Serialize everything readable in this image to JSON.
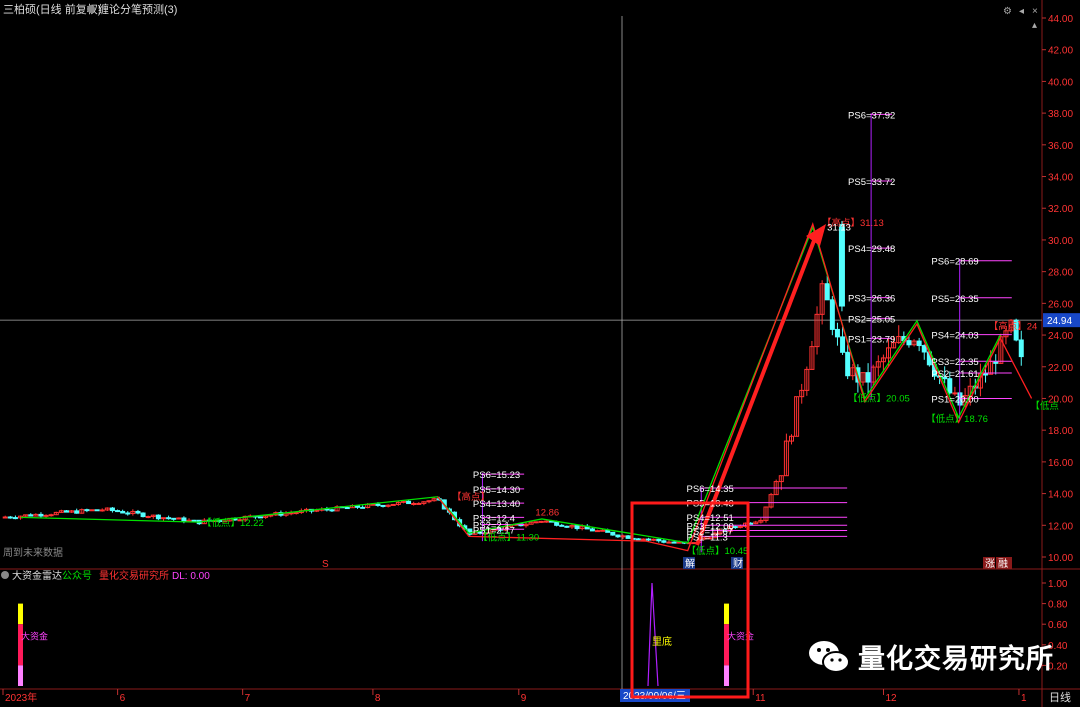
{
  "header": {
    "title": "三柏硕(日线 前复权)",
    "indicator": "缠论分笔预测(3)"
  },
  "sub_header": {
    "name": "大资金雷达",
    "tag1": "公众号",
    "tag2": "量化交易研究所",
    "dl_label": "DL: 0.00"
  },
  "left_note": "周到未来数据",
  "timeframe": "日线",
  "price_label": "24.94",
  "date_label": "2023/09/06/三",
  "watermark": "量化交易研究所",
  "badges": {
    "jie": "解",
    "cai": "财",
    "zhang": "涨",
    "zi": "融"
  },
  "colors": {
    "up": "#ff3232",
    "down": "#54ffff",
    "green": "#00e000",
    "red": "#ff2020",
    "magenta": "#ff44ff",
    "purple": "#b020ff",
    "box": "#ff1a1a"
  },
  "chart_data": [
    {
      "type": "candlestick",
      "ylim": [
        10.0,
        44.0
      ],
      "y_ticks": [
        "10.00",
        "12.00",
        "14.00",
        "16.00",
        "18.00",
        "20.00",
        "22.00",
        "24.00",
        "26.00",
        "28.00",
        "30.00",
        "32.00",
        "34.00",
        "36.00",
        "38.00",
        "40.00",
        "42.00",
        "44.00"
      ],
      "x_ticks": [
        "2023年",
        "6",
        "7",
        "8",
        "9",
        "10",
        "11",
        "12",
        "1"
      ],
      "stroke_green": [
        [
          0.02,
          12.5
        ],
        [
          0.19,
          12.2
        ],
        [
          0.42,
          13.8
        ],
        [
          0.45,
          11.5
        ],
        [
          0.52,
          12.4
        ],
        [
          0.66,
          10.9
        ],
        [
          0.78,
          30.8
        ],
        [
          0.83,
          20.0
        ],
        [
          0.88,
          24.9
        ],
        [
          0.92,
          18.8
        ],
        [
          0.96,
          24.0
        ]
      ],
      "stroke_red": [
        [
          0.42,
          13.8
        ],
        [
          0.45,
          11.3
        ],
        [
          0.62,
          11.0
        ],
        [
          0.66,
          10.4
        ],
        [
          0.78,
          31.0
        ],
        [
          0.83,
          19.8
        ],
        [
          0.88,
          24.7
        ],
        [
          0.92,
          18.5
        ],
        [
          0.96,
          23.8
        ],
        [
          0.99,
          20.0
        ]
      ],
      "labels": [
        {
          "t": "PS6=15.23",
          "x": 0.45,
          "y": 15.23,
          "c": "#fff"
        },
        {
          "t": "PS5=14.30",
          "x": 0.45,
          "y": 14.3,
          "c": "#fff"
        },
        {
          "t": "PS4=13.40",
          "x": 0.45,
          "y": 13.4,
          "c": "#fff"
        },
        {
          "t": "PS3=12.4",
          "x": 0.45,
          "y": 12.5,
          "c": "#fff"
        },
        {
          "t": "PS2=2.1",
          "x": 0.45,
          "y": 12.05,
          "c": "#fff"
        },
        {
          "t": "PS1=2.17",
          "x": 0.45,
          "y": 11.75,
          "c": "#fff"
        },
        {
          "t": "【高点】",
          "x": 0.43,
          "y": 13.85,
          "c": "#ff3232"
        },
        {
          "t": "12.86",
          "x": 0.51,
          "y": 12.86,
          "c": "#ff3232"
        },
        {
          "t": "【低点】11.30",
          "x": 0.455,
          "y": 11.3,
          "c": "#00e000"
        },
        {
          "t": "【低点】12.22",
          "x": 0.19,
          "y": 12.22,
          "c": "#00e000"
        },
        {
          "t": "PS6=14.35",
          "x": 0.655,
          "y": 14.35,
          "c": "#fff"
        },
        {
          "t": "PS5=13.43",
          "x": 0.655,
          "y": 13.43,
          "c": "#fff"
        },
        {
          "t": "PS4=12.51",
          "x": 0.655,
          "y": 12.51,
          "c": "#fff"
        },
        {
          "t": "PS3=12.00",
          "x": 0.655,
          "y": 12.0,
          "c": "#fff"
        },
        {
          "t": "PS2=11.67",
          "x": 0.655,
          "y": 11.67,
          "c": "#fff"
        },
        {
          "t": "PS1=11.3",
          "x": 0.655,
          "y": 11.3,
          "c": "#fff"
        },
        {
          "t": "【低点】10.45",
          "x": 0.655,
          "y": 10.45,
          "c": "#00e000"
        },
        {
          "t": "PS6=37.92",
          "x": 0.81,
          "y": 37.92,
          "c": "#fff"
        },
        {
          "t": "PS5=33.72",
          "x": 0.81,
          "y": 33.72,
          "c": "#fff"
        },
        {
          "t": "PS4=29.48",
          "x": 0.81,
          "y": 29.48,
          "c": "#fff"
        },
        {
          "t": "PS3=26.36",
          "x": 0.81,
          "y": 26.36,
          "c": "#fff"
        },
        {
          "t": "PS2=25.05",
          "x": 0.81,
          "y": 25.05,
          "c": "#fff"
        },
        {
          "t": "PS1=23.79",
          "x": 0.81,
          "y": 23.79,
          "c": "#fff"
        },
        {
          "t": "【高点】31.13",
          "x": 0.785,
          "y": 31.13,
          "c": "#ff3232"
        },
        {
          "t": "31.13",
          "x": 0.79,
          "y": 30.85,
          "c": "#fff"
        },
        {
          "t": "【低点】20.05",
          "x": 0.81,
          "y": 20.05,
          "c": "#00e000"
        },
        {
          "t": "PS6=28.69",
          "x": 0.89,
          "y": 28.69,
          "c": "#fff"
        },
        {
          "t": "PS5=26.35",
          "x": 0.89,
          "y": 26.35,
          "c": "#fff"
        },
        {
          "t": "PS4=24.03",
          "x": 0.89,
          "y": 24.03,
          "c": "#fff"
        },
        {
          "t": "PS3=22.35",
          "x": 0.89,
          "y": 22.35,
          "c": "#fff"
        },
        {
          "t": "PS2=21.61",
          "x": 0.89,
          "y": 21.61,
          "c": "#fff"
        },
        {
          "t": "PS1=20.00",
          "x": 0.89,
          "y": 20.0,
          "c": "#fff"
        },
        {
          "t": "【高点】24",
          "x": 0.945,
          "y": 24.6,
          "c": "#ff3232"
        },
        {
          "t": "【低点】18.76",
          "x": 0.885,
          "y": 18.76,
          "c": "#00e000"
        },
        {
          "t": "【低点",
          "x": 0.985,
          "y": 19.6,
          "c": "#00e000"
        }
      ]
    },
    {
      "type": "bar",
      "name": "大资金雷达",
      "ylim": [
        0.0,
        1.0
      ],
      "y_ticks": [
        "0.20",
        "0.40",
        "0.60",
        "0.80",
        "1.00"
      ],
      "spike": {
        "x": 0.605,
        "peak": 1.0
      },
      "bars": [
        {
          "x": 0.02,
          "label": "大资金"
        },
        {
          "x": 0.67,
          "label": "大资金"
        }
      ],
      "center_label": "里底"
    }
  ]
}
